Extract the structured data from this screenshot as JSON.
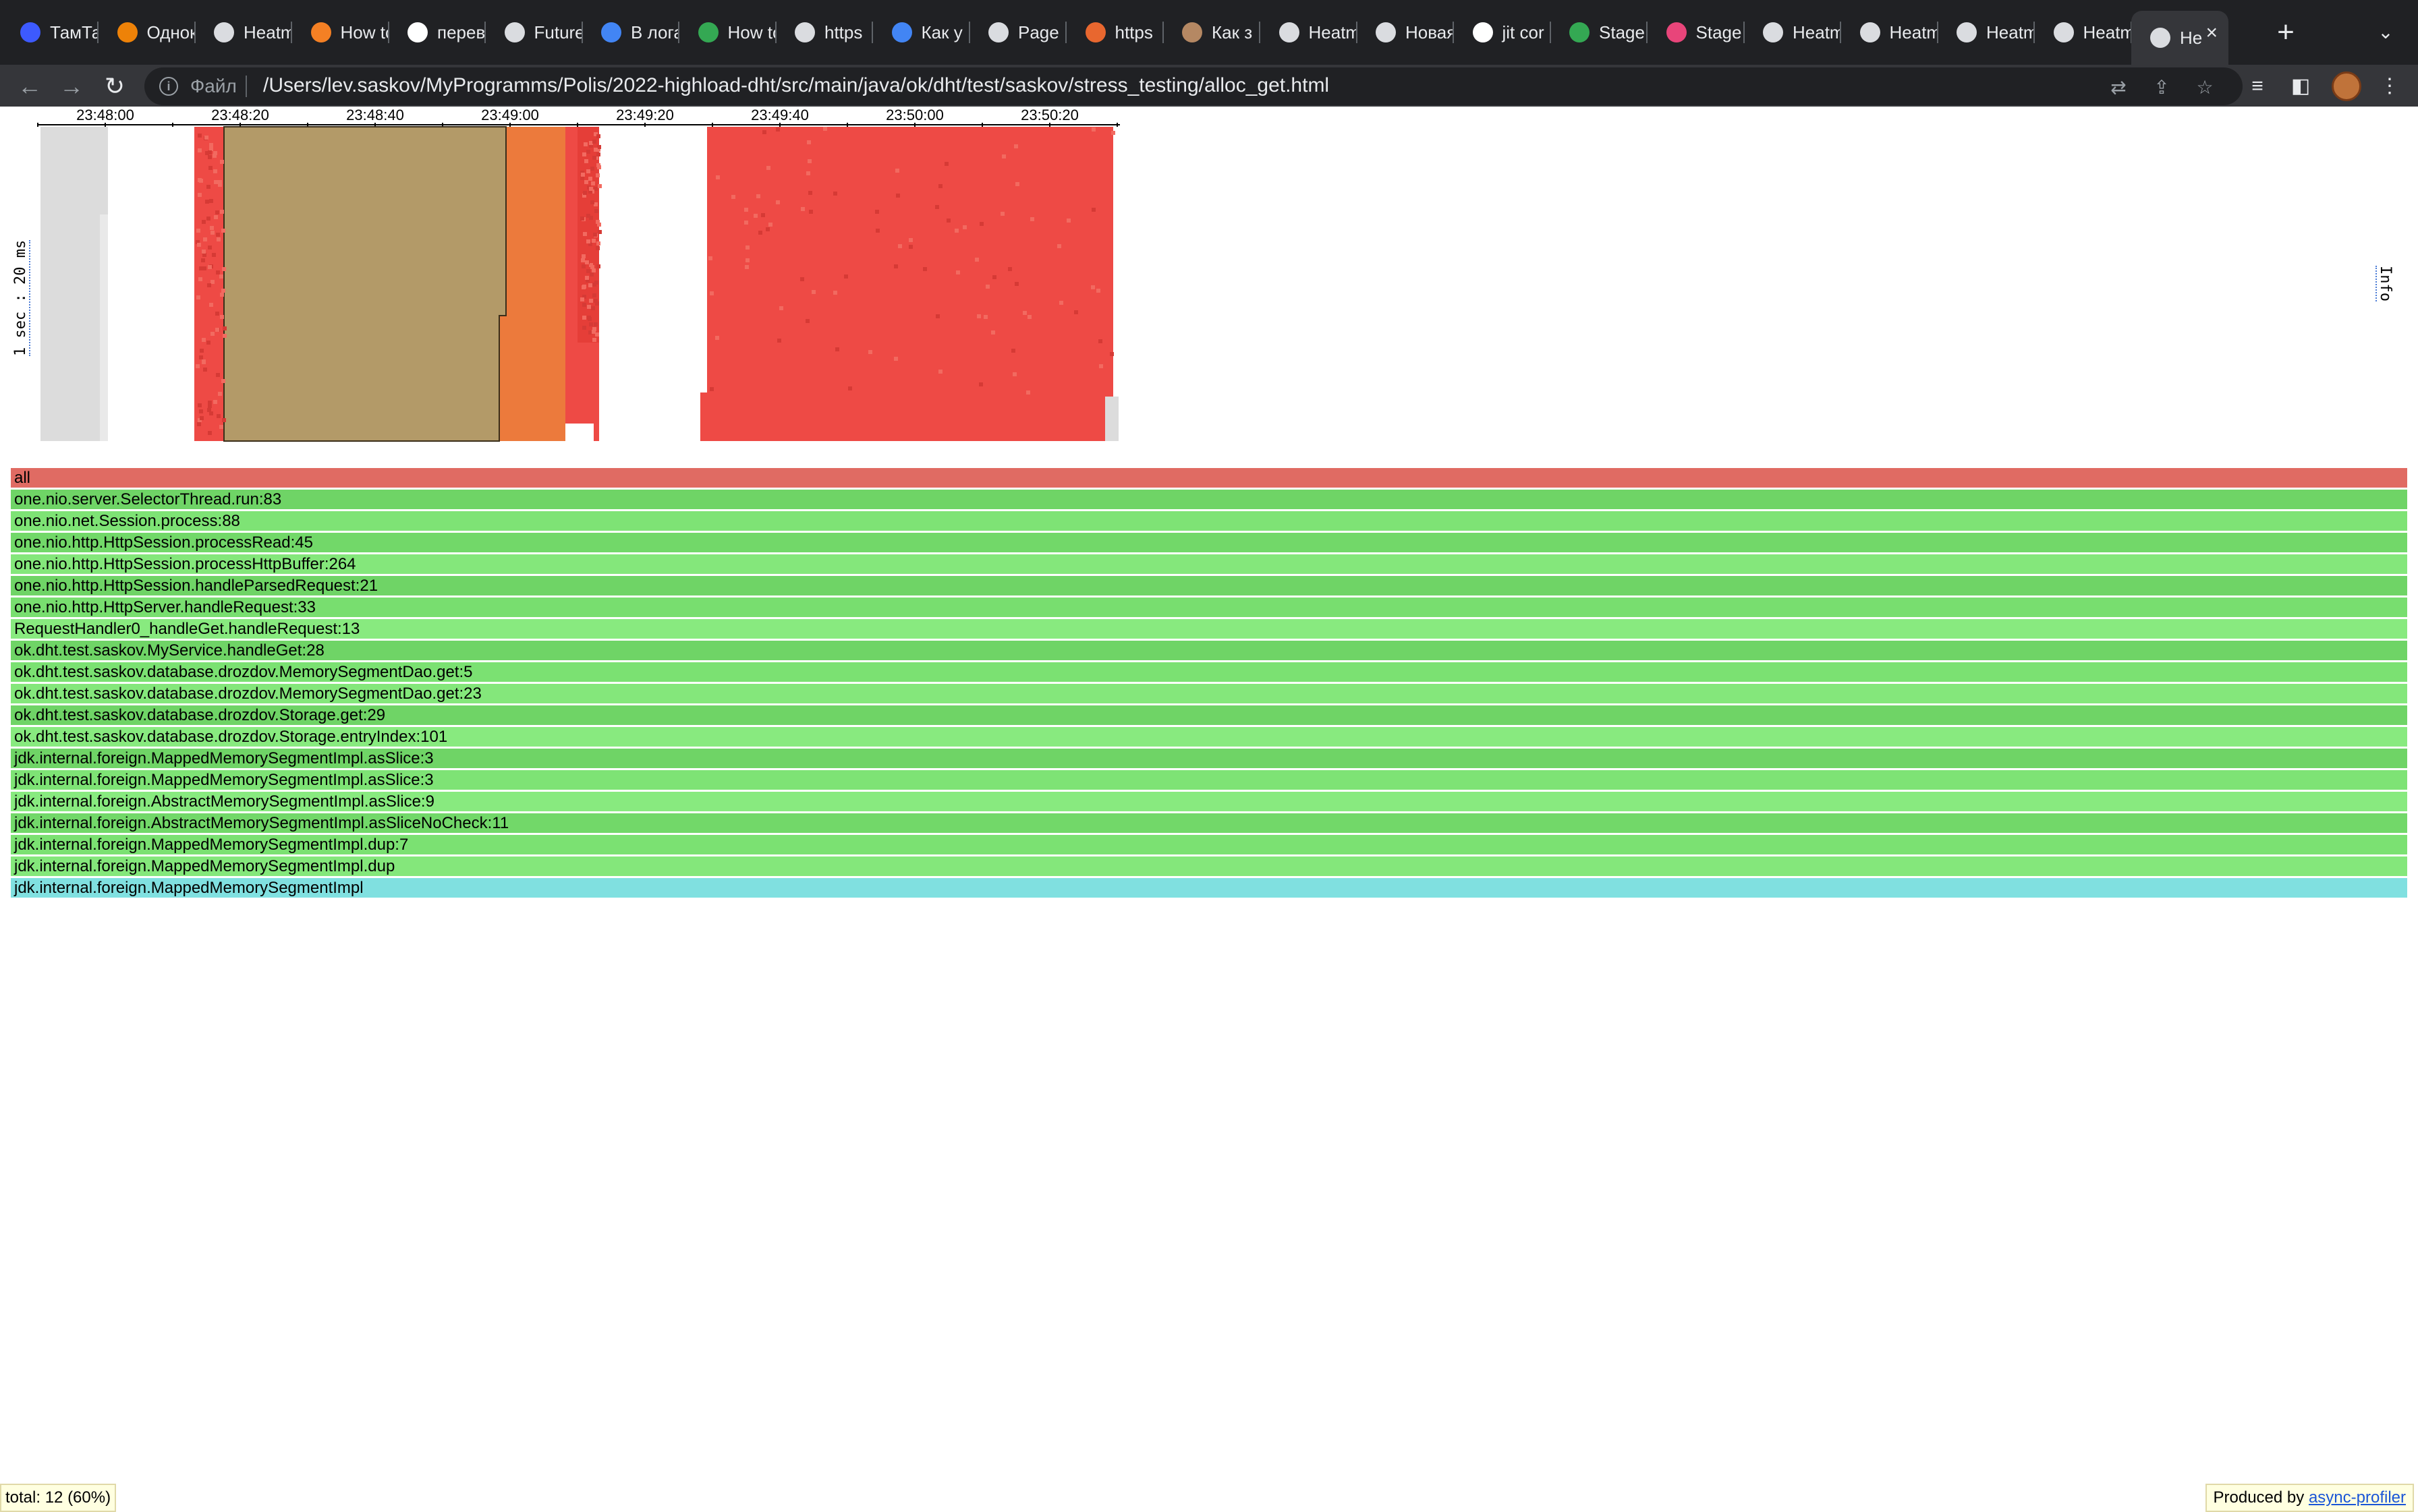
{
  "browser": {
    "tabs": [
      {
        "title": "ТамТам",
        "favicon": "tamtam-icon",
        "color": "#3d5afe"
      },
      {
        "title": "Одноклассники",
        "favicon": "odnoklassniki-icon",
        "color": "#ee8208"
      },
      {
        "title": "Heatmap",
        "favicon": "globe-icon",
        "color": "#dadce0"
      },
      {
        "title": "How to",
        "favicon": "stackoverflow-icon",
        "color": "#f48024"
      },
      {
        "title": "перевод",
        "favicon": "google-icon",
        "color": "#ffffff"
      },
      {
        "title": "Future",
        "favicon": "globe-icon",
        "color": "#dadce0"
      },
      {
        "title": "В логах",
        "favicon": "doc-icon",
        "color": "#4285f4"
      },
      {
        "title": "How to",
        "favicon": "glasses-icon",
        "color": "#34a853"
      },
      {
        "title": "https",
        "favicon": "globe-icon",
        "color": "#dadce0"
      },
      {
        "title": "Как у",
        "favicon": "doc-icon",
        "color": "#4285f4"
      },
      {
        "title": "Page",
        "favicon": "globe-icon",
        "color": "#dadce0"
      },
      {
        "title": "https",
        "favicon": "shield-icon",
        "color": "#e8672f"
      },
      {
        "title": "Как з",
        "favicon": "avatar-icon",
        "color": "#b58863"
      },
      {
        "title": "Heatmap",
        "favicon": "globe-icon",
        "color": "#dadce0"
      },
      {
        "title": "Новая",
        "favicon": "chrome-icon",
        "color": "#dadce0"
      },
      {
        "title": "jit cor",
        "favicon": "google-icon",
        "color": "#ffffff"
      },
      {
        "title": "Stage",
        "favicon": "check-icon",
        "color": "#34a853"
      },
      {
        "title": "Stage",
        "favicon": "chart-icon",
        "color": "#e8457a"
      },
      {
        "title": "Heatmap",
        "favicon": "globe-icon",
        "color": "#dadce0"
      },
      {
        "title": "Heatmap",
        "favicon": "globe-icon",
        "color": "#dadce0"
      },
      {
        "title": "Heatmap",
        "favicon": "globe-icon",
        "color": "#dadce0"
      },
      {
        "title": "Heatmap",
        "favicon": "globe-icon",
        "color": "#dadce0"
      },
      {
        "title": "Не",
        "favicon": "globe-icon",
        "color": "#dadce0",
        "active": true
      }
    ],
    "scheme_label": "Файл",
    "url": "/Users/lev.saskov/MyProgramms/Polis/2022-highload-dht/src/main/java/ok/dht/test/saskov/stress_testing/alloc_get.html"
  },
  "heatmap": {
    "time_ticks": [
      "23:48:00",
      "23:48:20",
      "23:48:40",
      "23:49:00",
      "23:49:20",
      "23:49:40",
      "23:50:00",
      "23:50:20"
    ],
    "y_label": "1 sec : 20 ms",
    "info_label": "Info",
    "colors": {
      "idle": "#dcdcdc",
      "hot": "#ee4a45",
      "highlight": "#b39a68",
      "orange": "#ec7a3c"
    }
  },
  "flamegraph": {
    "frames": [
      {
        "label": "all",
        "color": "#e06b63"
      },
      {
        "label": "one.nio.server.SelectorThread.run:83",
        "color": "#6fd466"
      },
      {
        "label": "one.nio.net.Session.process:88",
        "color": "#7ee375"
      },
      {
        "label": "one.nio.http.HttpSession.processRead:45",
        "color": "#72d869"
      },
      {
        "label": "one.nio.http.HttpSession.processHttpBuffer:264",
        "color": "#84e77b"
      },
      {
        "label": "one.nio.http.HttpSession.handleParsedRequest:21",
        "color": "#6fd466"
      },
      {
        "label": "one.nio.http.HttpServer.handleRequest:33",
        "color": "#78de6f"
      },
      {
        "label": "RequestHandler0_handleGet.handleRequest:13",
        "color": "#88ea7f"
      },
      {
        "label": "ok.dht.test.saskov.MyService.handleGet:28",
        "color": "#6fd466"
      },
      {
        "label": "ok.dht.test.saskov.database.drozdov.MemorySegmentDao.get:5",
        "color": "#7be172"
      },
      {
        "label": "ok.dht.test.saskov.database.drozdov.MemorySegmentDao.get:23",
        "color": "#84e77b"
      },
      {
        "label": "ok.dht.test.saskov.database.drozdov.Storage.get:29",
        "color": "#6fd466"
      },
      {
        "label": "ok.dht.test.saskov.database.drozdov.Storage.entryIndex:101",
        "color": "#88ea7f"
      },
      {
        "label": "jdk.internal.foreign.MappedMemorySegmentImpl.asSlice:3",
        "color": "#6fd466"
      },
      {
        "label": "jdk.internal.foreign.MappedMemorySegmentImpl.asSlice:3",
        "color": "#7ee375"
      },
      {
        "label": "jdk.internal.foreign.AbstractMemorySegmentImpl.asSlice:9",
        "color": "#88ea7f"
      },
      {
        "label": "jdk.internal.foreign.AbstractMemorySegmentImpl.asSliceNoCheck:11",
        "color": "#72d869"
      },
      {
        "label": "jdk.internal.foreign.MappedMemorySegmentImpl.dup:7",
        "color": "#7be172"
      },
      {
        "label": "jdk.internal.foreign.MappedMemorySegmentImpl.dup",
        "color": "#84e77b"
      },
      {
        "label": "jdk.internal.foreign.MappedMemorySegmentImpl",
        "color": "#80e0e0"
      }
    ]
  },
  "status": {
    "total": "total: 12 (60%)",
    "produced_by": "Produced by",
    "profiler_link": "async-profiler"
  }
}
